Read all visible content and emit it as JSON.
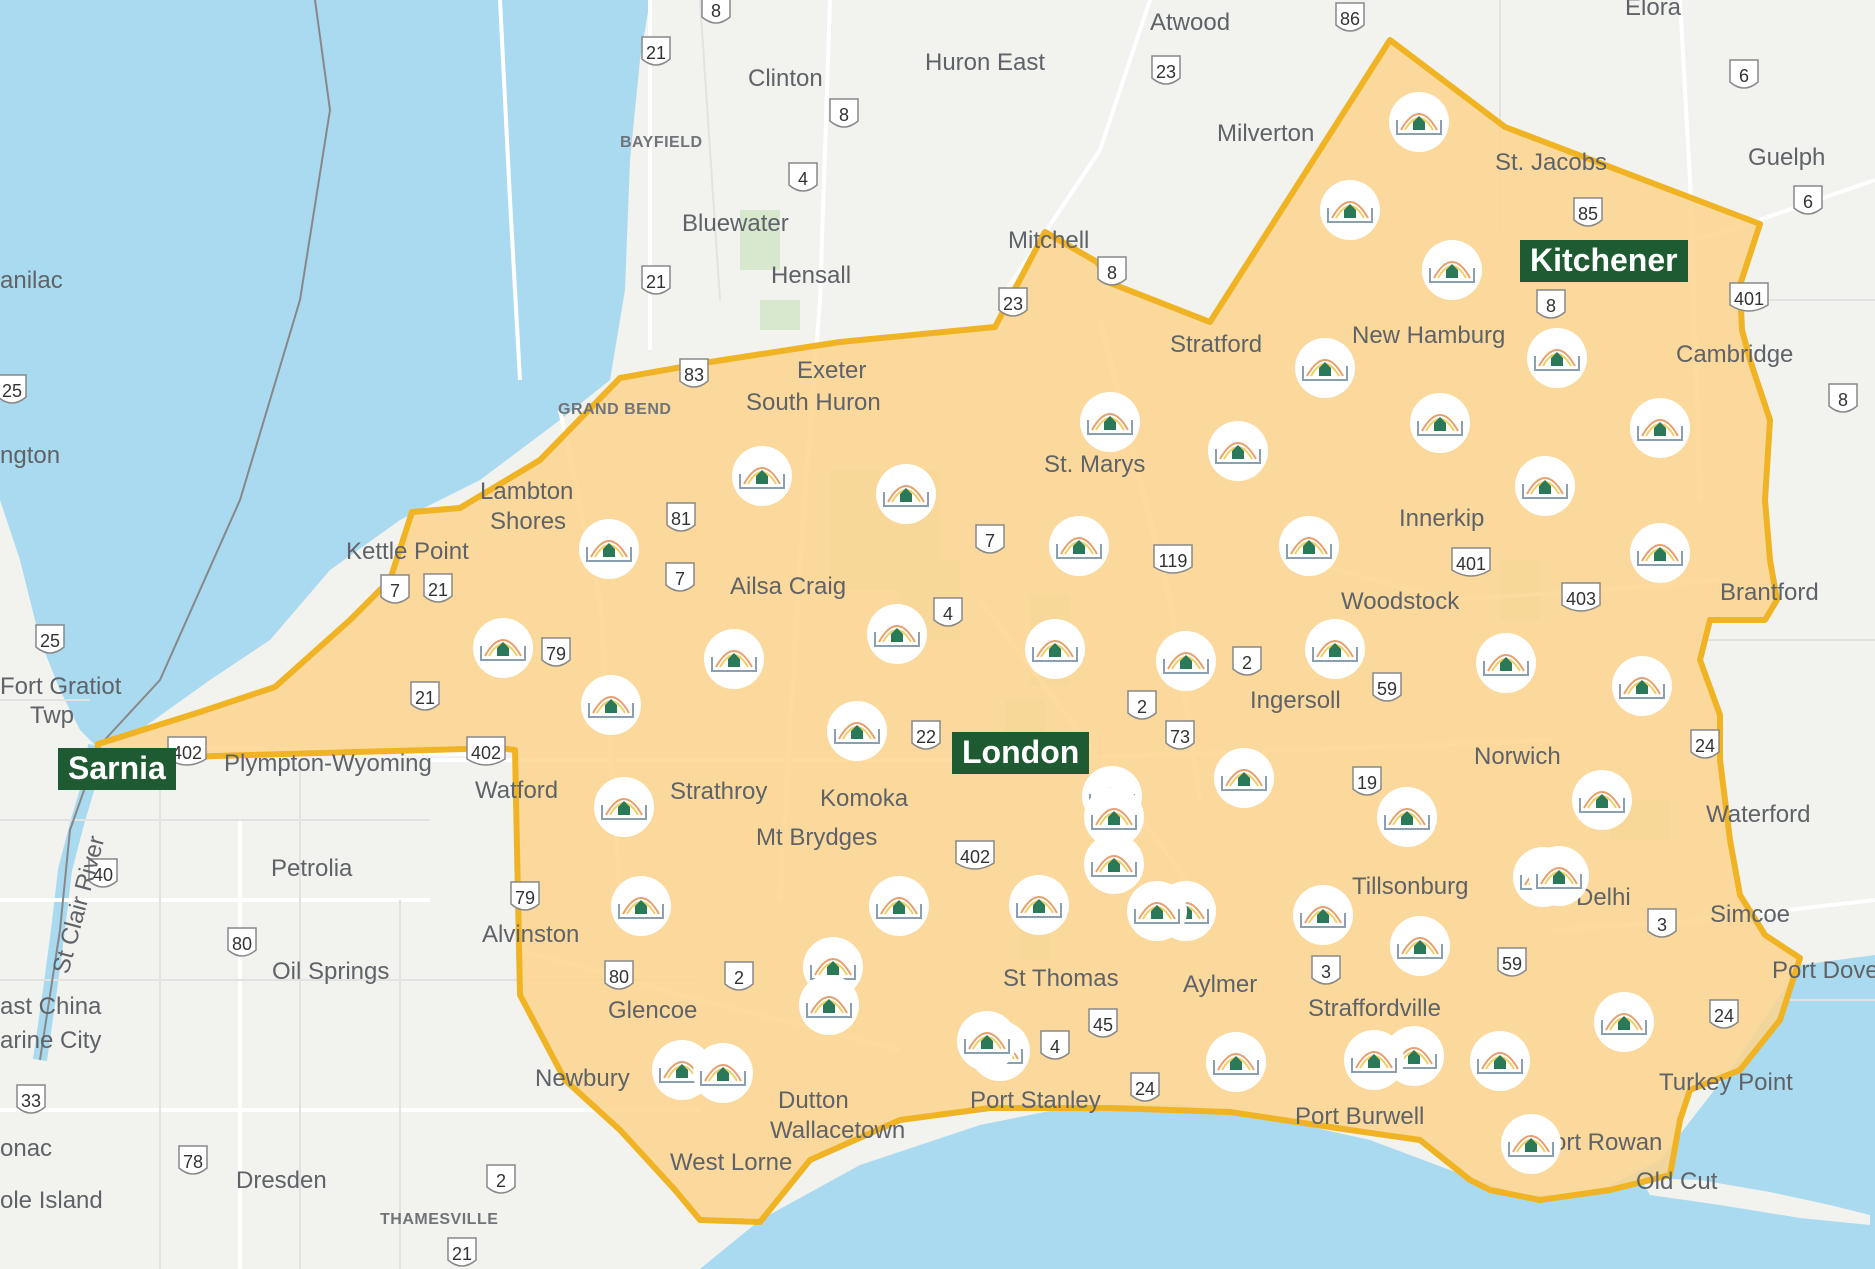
{
  "map": {
    "colors": {
      "water": "#aadaef",
      "land": "#f2f2ef",
      "service_area_fill": "#fdd58e",
      "service_area_stroke": "#f0b323",
      "city_label_bg": "#1e5a32",
      "city_label_text": "#ffffff",
      "marker_bg": "#ffffff"
    },
    "service_area_name": "",
    "featured_cities": [
      {
        "id": "sarnia",
        "label": "Sarnia"
      },
      {
        "id": "london",
        "label": "London"
      },
      {
        "id": "kitchener",
        "label": "Kitchener"
      }
    ],
    "place_labels": [
      {
        "id": "atwood",
        "text": "Atwood"
      },
      {
        "id": "elora",
        "text": "Elora"
      },
      {
        "id": "huron-east",
        "text": "Huron East"
      },
      {
        "id": "clinton",
        "text": "Clinton"
      },
      {
        "id": "bayfield",
        "text": "BAYFIELD"
      },
      {
        "id": "milverton",
        "text": "Milverton"
      },
      {
        "id": "st-jacobs",
        "text": "St. Jacobs"
      },
      {
        "id": "guelph",
        "text": "Guelph"
      },
      {
        "id": "bluewater",
        "text": "Bluewater"
      },
      {
        "id": "mitchell",
        "text": "Mitchell"
      },
      {
        "id": "sanilac",
        "text": "anilac"
      },
      {
        "id": "hensall",
        "text": "Hensall"
      },
      {
        "id": "stratford",
        "text": "Stratford"
      },
      {
        "id": "new-hamburg",
        "text": "New Hamburg"
      },
      {
        "id": "cambridge",
        "text": "Cambridge"
      },
      {
        "id": "exeter",
        "text": "Exeter"
      },
      {
        "id": "south-huron",
        "text": "South Huron"
      },
      {
        "id": "grand-bend",
        "text": "GRAND BEND"
      },
      {
        "id": "lexington",
        "text": "ngton"
      },
      {
        "id": "st-marys",
        "text": "St. Marys"
      },
      {
        "id": "lambton-shores-1",
        "text": "Lambton"
      },
      {
        "id": "lambton-shores-2",
        "text": "Shores"
      },
      {
        "id": "innerkip",
        "text": "Innerkip"
      },
      {
        "id": "kettle-point",
        "text": "Kettle Point"
      },
      {
        "id": "ailsa-craig",
        "text": "Ailsa Craig"
      },
      {
        "id": "woodstock",
        "text": "Woodstock"
      },
      {
        "id": "brantford",
        "text": "Brantford"
      },
      {
        "id": "fort-gratiot-1",
        "text": "Fort Gratiot"
      },
      {
        "id": "fort-gratiot-2",
        "text": "Twp"
      },
      {
        "id": "ingersoll",
        "text": "Ingersoll"
      },
      {
        "id": "plympton-wyoming",
        "text": "Plympton-Wyoming"
      },
      {
        "id": "norwich",
        "text": "Norwich"
      },
      {
        "id": "watford",
        "text": "Watford"
      },
      {
        "id": "strathroy",
        "text": "Strathroy"
      },
      {
        "id": "komoka",
        "text": "Komoka"
      },
      {
        "id": "waterford",
        "text": "Waterford"
      },
      {
        "id": "mt-brydges",
        "text": "Mt Brydges"
      },
      {
        "id": "petrolia",
        "text": "Petrolia"
      },
      {
        "id": "tillsonburg",
        "text": "Tillsonburg"
      },
      {
        "id": "delhi",
        "text": "Delhi"
      },
      {
        "id": "simcoe",
        "text": "Simcoe"
      },
      {
        "id": "alvinston",
        "text": "Alvinston"
      },
      {
        "id": "oil-springs",
        "text": "Oil Springs"
      },
      {
        "id": "port-dover",
        "text": "Port Dove"
      },
      {
        "id": "st-thomas",
        "text": "St Thomas"
      },
      {
        "id": "aylmer",
        "text": "Aylmer"
      },
      {
        "id": "east-china",
        "text": "ast China"
      },
      {
        "id": "glencoe",
        "text": "Glencoe"
      },
      {
        "id": "straffordville",
        "text": "Straffordville"
      },
      {
        "id": "marine-city",
        "text": "arine City"
      },
      {
        "id": "newbury",
        "text": "Newbury"
      },
      {
        "id": "turkey-point",
        "text": "Turkey Point"
      },
      {
        "id": "dutton",
        "text": "Dutton"
      },
      {
        "id": "port-stanley",
        "text": "Port Stanley"
      },
      {
        "id": "port-burwell",
        "text": "Port Burwell"
      },
      {
        "id": "wallacetown",
        "text": "Wallacetown"
      },
      {
        "id": "port-rowan",
        "text": "Port Rowan"
      },
      {
        "id": "west-lorne",
        "text": "West Lorne"
      },
      {
        "id": "algonac",
        "text": "onac"
      },
      {
        "id": "dresden",
        "text": "Dresden"
      },
      {
        "id": "old-cut",
        "text": "Old Cut"
      },
      {
        "id": "harsens-island",
        "text": "ole Island"
      },
      {
        "id": "thamesville",
        "text": "THAMESVILLE"
      },
      {
        "id": "st-clair-river",
        "text": "St Clair River"
      }
    ],
    "route_shields": [
      "8",
      "86",
      "21",
      "8",
      "23",
      "6",
      "4",
      "21",
      "6",
      "85",
      "8",
      "8",
      "23",
      "401",
      "83",
      "8",
      "25",
      "81",
      "7",
      "119",
      "401",
      "403",
      "7",
      "21",
      "7",
      "4",
      "79",
      "25",
      "21",
      "2",
      "59",
      "2",
      "73",
      "402",
      "402",
      "22",
      "24",
      "19",
      "402",
      "40",
      "79",
      "3",
      "80",
      "80",
      "2",
      "59",
      "24",
      "45",
      "3",
      "4",
      "24",
      "33",
      "78",
      "2",
      "21"
    ]
  }
}
